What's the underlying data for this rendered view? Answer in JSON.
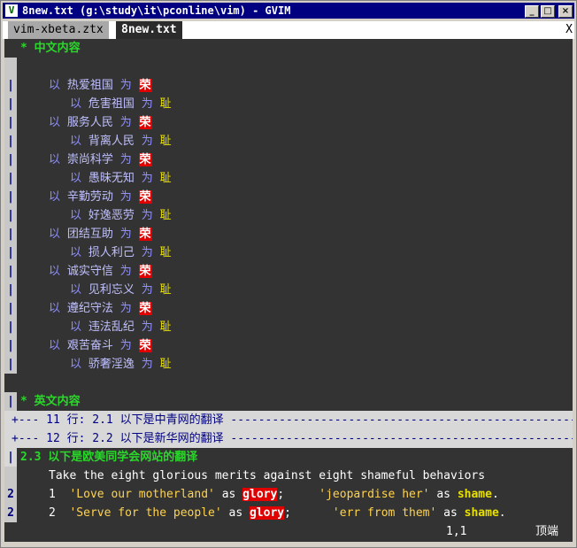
{
  "window": {
    "title": "8new.txt (g:\\study\\it\\pconline\\vim) - GVIM",
    "app_icon": "vim-icon",
    "minimize": "_",
    "maximize": "□",
    "close": "×"
  },
  "tabs": [
    {
      "label": "vim-xbeta.ztx"
    },
    {
      "label": "8new.txt"
    }
  ],
  "tab_close": "X",
  "section1": {
    "marker": "*",
    "title": "中文内容"
  },
  "section2": {
    "marker": "*",
    "title": "英文内容"
  },
  "pairs": [
    {
      "good": "热爱祖国",
      "bad": "危害祖国"
    },
    {
      "good": "服务人民",
      "bad": "背离人民"
    },
    {
      "good": "崇尚科学",
      "bad": "愚昧无知"
    },
    {
      "good": "辛勤劳动",
      "bad": "好逸恶劳"
    },
    {
      "good": "团结互助",
      "bad": "损人利己"
    },
    {
      "good": "诚实守信",
      "bad": "见利忘义"
    },
    {
      "good": "遵纪守法",
      "bad": "违法乱纪"
    },
    {
      "good": "艰苦奋斗",
      "bad": "骄奢淫逸"
    }
  ],
  "words": {
    "yi": "以",
    "wei": "为",
    "rong": "荣",
    "chi": "耻"
  },
  "folds": [
    {
      "text": "+--- 11 行: 2.1 以下是中青网的翻译 -----------------------------------------------------"
    },
    {
      "text": "+--- 12 行: 2.2 以下是新华网的翻译 -----------------------------------------------------"
    }
  ],
  "section23": {
    "title": "2.3 以下是欧美同学会网站的翻译"
  },
  "english": {
    "intro": "Take the eight glorious merits against eight shameful behaviors",
    "rows": [
      {
        "n": "1",
        "good": "'Love our motherland'",
        "as": "as",
        "glory": "glory",
        "semi": ";",
        "bad": "'jeopardise her'",
        "shame": "shame",
        "dot": "."
      },
      {
        "n": "2",
        "good": "'Serve for the people'",
        "as": "as",
        "glory": "glory",
        "semi": ";",
        "bad": "'err from them'",
        "shame": "shame",
        "dot": "."
      }
    ]
  },
  "foldcol": {
    "bar": "|",
    "two": "2"
  },
  "status": {
    "position": "1,1",
    "scroll": "顶端"
  }
}
